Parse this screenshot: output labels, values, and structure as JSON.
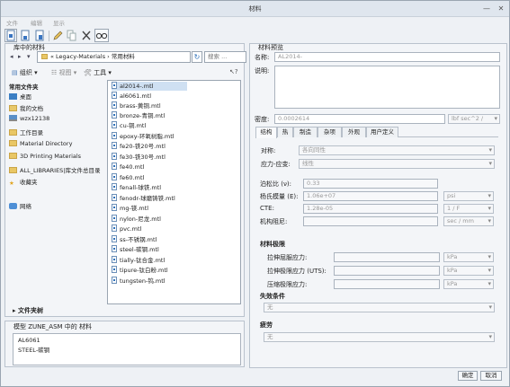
{
  "window": {
    "title": "材料"
  },
  "menu": [
    "文件",
    "编辑",
    "显示"
  ],
  "library": {
    "title": "库中的材料",
    "path": "« Legacy-Materials › 常用材料",
    "search_placeholder": "搜索 ...",
    "commands": {
      "organize": "组织",
      "view": "视图",
      "tools": "工具"
    },
    "favorites_title": "常用文件夹",
    "favorites": [
      {
        "label": "桌面",
        "icon": "desktop-icon"
      },
      {
        "label": "我的文档",
        "icon": "documents-icon"
      },
      {
        "label": "wzx12138",
        "icon": "computer-icon"
      },
      {
        "label": "工作目录",
        "icon": "folder-icon"
      },
      {
        "label": "Material Directory",
        "icon": "folder-icon"
      },
      {
        "label": "3D Printing Materials",
        "icon": "folder-icon"
      },
      {
        "label": "ALL_LIBRARIES|库文件总目录",
        "icon": "folder-icon"
      },
      {
        "label": "收藏夹",
        "icon": "star-icon"
      },
      {
        "label": "网络",
        "icon": "network-icon"
      }
    ],
    "folder_tree": "文件夹树",
    "files": [
      "al2014-.mtl",
      "al6061.mtl",
      "brass-黄铜.mtl",
      "bronze-青铜.mtl",
      "cu-铜.mtl",
      "epoxy-环氧树脂.mtl",
      "fe20-铁20号.mtl",
      "fe30-铁30号.mtl",
      "fe40.mtl",
      "fe60.mtl",
      "fenall-球铁.mtl",
      "fenodr-球磨铸铁.mtl",
      "mg-镁.mtl",
      "nylon-尼龙.mtl",
      "pvc.mtl",
      "ss-不锈钢.mtl",
      "steel-碳钢.mtl",
      "tially-钛合金.mtl",
      "tipure-钛白粉.mtl",
      "tungsten-钨.mtl"
    ],
    "selected_file": "al2014-.mtl"
  },
  "model": {
    "title": "模型 ZUNE_ASM 中的 材料",
    "items": [
      "AL6061",
      "STEEL-碳钢"
    ]
  },
  "preview": {
    "title": "材料预览",
    "name_label": "名称:",
    "name_value": "AL2014-",
    "desc_label": "说明:",
    "density_label": "密度:",
    "density_value": "0.0002614",
    "density_unit": "lbf sec^2 /",
    "tabs": [
      "结构",
      "热",
      "制造",
      "杂项",
      "外观",
      "用户定义"
    ],
    "active_tab": "结构",
    "symmetry_label": "对称:",
    "symmetry_value": "各向同性",
    "stress_strain_label": "应力-应变:",
    "stress_strain_value": "线性",
    "poisson_label": "泊松比 (ν):",
    "poisson_value": "0.33",
    "young_label": "杨氏模量 (E):",
    "young_value": "1.06e+07",
    "young_unit": "psi",
    "cte_label": "CTE:",
    "cte_value": "1.28e-05",
    "cte_unit": "1 / F",
    "damping_label": "机构阻尼:",
    "damping_unit": "sec / mm",
    "limits_title": "材料极限",
    "tensile_yield_label": "拉伸屈服应力:",
    "tensile_ultimate_label": "拉伸极限应力 (UTS):",
    "compressive_label": "压缩极限应力:",
    "limit_unit": "kPa",
    "failure_title": "失效条件",
    "failure_value": "无",
    "fatigue_title": "疲劳",
    "fatigue_value": "无"
  },
  "buttons": {
    "ok": "确定",
    "cancel": "取消"
  }
}
